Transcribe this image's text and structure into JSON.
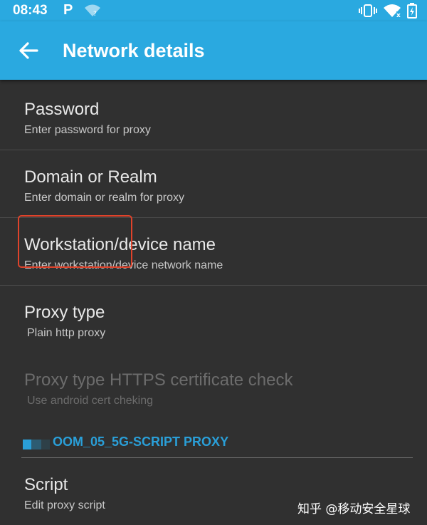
{
  "status_bar": {
    "time": "08:43",
    "app_icon": "P"
  },
  "app_bar": {
    "title": "Network details"
  },
  "preferences": [
    {
      "title": "Password",
      "summary": "Enter password for proxy"
    },
    {
      "title": "Domain or Realm",
      "summary": "Enter domain or realm for proxy"
    },
    {
      "title": "Workstation/device name",
      "summary": "Enter workstation/device network name"
    },
    {
      "title": "Proxy type",
      "summary": "Plain http proxy"
    },
    {
      "title": "Proxy type HTTPS certificate check",
      "summary": "Use android cert cheking"
    }
  ],
  "category": {
    "label": "OOM_05_5G-SCRIPT PROXY"
  },
  "script_pref": {
    "title": "Script",
    "summary": "Edit proxy script"
  },
  "watermark": "知乎 @移动安全星球",
  "colors": {
    "accent": "#2aa9e0",
    "highlight": "#e0432b",
    "background": "#303030"
  }
}
